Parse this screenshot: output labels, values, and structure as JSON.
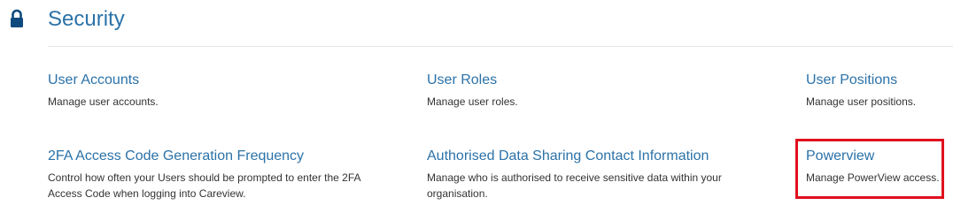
{
  "section": {
    "icon": "lock-icon",
    "title": "Security",
    "accent_color": "#2b72a8"
  },
  "items": [
    {
      "label": "User Accounts",
      "description": "Manage user accounts."
    },
    {
      "label": "User Roles",
      "description": "Manage user roles."
    },
    {
      "label": "User Positions",
      "description": "Manage user positions."
    },
    {
      "label": "2FA Access Code Generation Frequency",
      "description": "Control how often your Users should be prompted to enter the 2FA Access Code when logging into Careview."
    },
    {
      "label": "Authorised Data Sharing Contact Information",
      "description": "Manage who is authorised to receive sensitive data within your organisation."
    },
    {
      "label": "Powerview",
      "description": "Manage PowerView access."
    }
  ],
  "highlight": {
    "target": "Powerview",
    "color": "#e0101e"
  }
}
